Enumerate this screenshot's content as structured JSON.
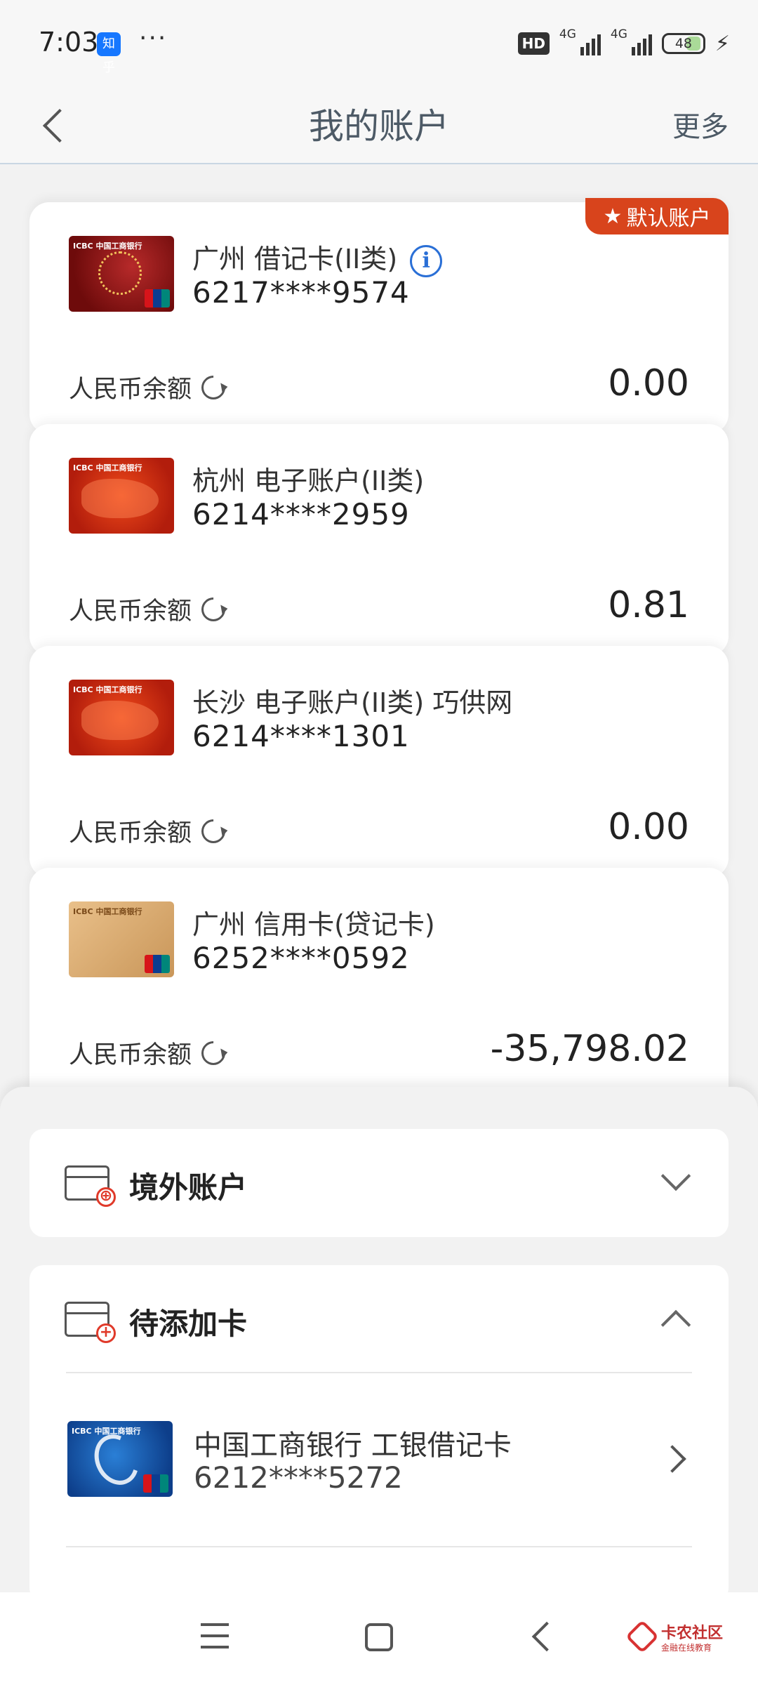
{
  "status_bar": {
    "time": "7:03",
    "app_icon_label": "知乎",
    "overflow": "···",
    "hd_label": "HD",
    "network_1": "4G",
    "network_2": "4G",
    "battery": "48"
  },
  "header": {
    "title": "我的账户",
    "more_label": "更多"
  },
  "default_badge": "默认账户",
  "balance_label": "人民币余额",
  "accounts": [
    {
      "name": "广州 借记卡(II类)",
      "number": "6217****9574",
      "balance": "0.00",
      "card_art": "red-tree"
    },
    {
      "name": "杭州 电子账户(II类)",
      "number": "6214****2959",
      "balance": "0.81",
      "card_art": "red-map"
    },
    {
      "name": "长沙 电子账户(II类) 巧供网",
      "number": "6214****1301",
      "balance": "0.00",
      "card_art": "red-map"
    },
    {
      "name": "广州 信用卡(贷记卡)",
      "number": "6252****0592",
      "balance": "-35,798.02",
      "card_art": "gold-map"
    }
  ],
  "card_art_bank_label": "ICBC 中国工商银行",
  "overseas": {
    "title": "境外账户"
  },
  "pending": {
    "title": "待添加卡",
    "items": [
      {
        "name": "中国工商银行  工银借记卡",
        "number": "6212****5272",
        "card_art": "blue-e"
      }
    ]
  },
  "watermark": {
    "title": "卡农社区",
    "subtitle": "金融在线教育"
  },
  "colors": {
    "accent_red": "#d8441c",
    "info_blue": "#2a6fd6",
    "title_gray": "#4d5a66"
  }
}
